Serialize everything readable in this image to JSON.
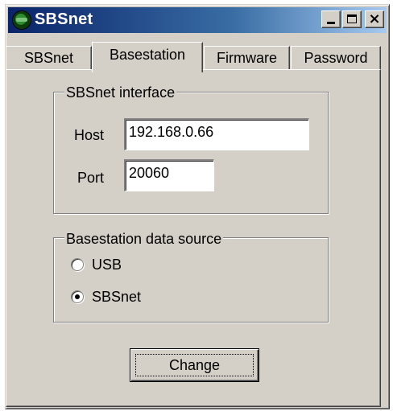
{
  "window": {
    "title": "SBSnet",
    "controls": {
      "minimize": "_",
      "maximize": "□",
      "close": "×"
    }
  },
  "tabs": [
    {
      "label": "SBSnet",
      "active": false
    },
    {
      "label": "Basestation",
      "active": true
    },
    {
      "label": "Firmware",
      "active": false
    },
    {
      "label": "Password",
      "active": false
    }
  ],
  "interface_group": {
    "legend": "SBSnet interface",
    "host_label": "Host",
    "host_value": "192.168.0.66",
    "port_label": "Port",
    "port_value": "20060"
  },
  "source_group": {
    "legend": "Basestation data source",
    "options": [
      {
        "label": "USB",
        "selected": false
      },
      {
        "label": "SBSnet",
        "selected": true
      }
    ]
  },
  "actions": {
    "change_label": "Change"
  }
}
